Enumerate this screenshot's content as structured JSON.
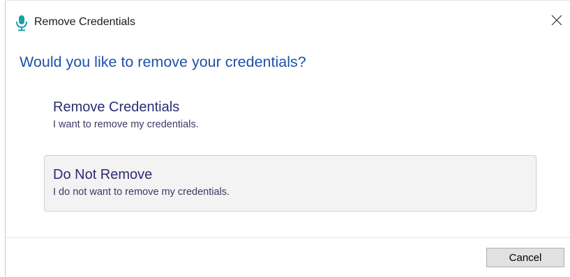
{
  "window": {
    "title": "Remove Credentials",
    "icon": "microphone-icon",
    "accent_color": "#19a0a8"
  },
  "dialog": {
    "question": "Would you like to remove your credentials?",
    "options": [
      {
        "title": "Remove Credentials",
        "subtitle": "I want to remove my credentials."
      },
      {
        "title": "Do Not Remove",
        "subtitle": "I do not want to remove my credentials."
      }
    ]
  },
  "footer": {
    "cancel_label": "Cancel"
  }
}
